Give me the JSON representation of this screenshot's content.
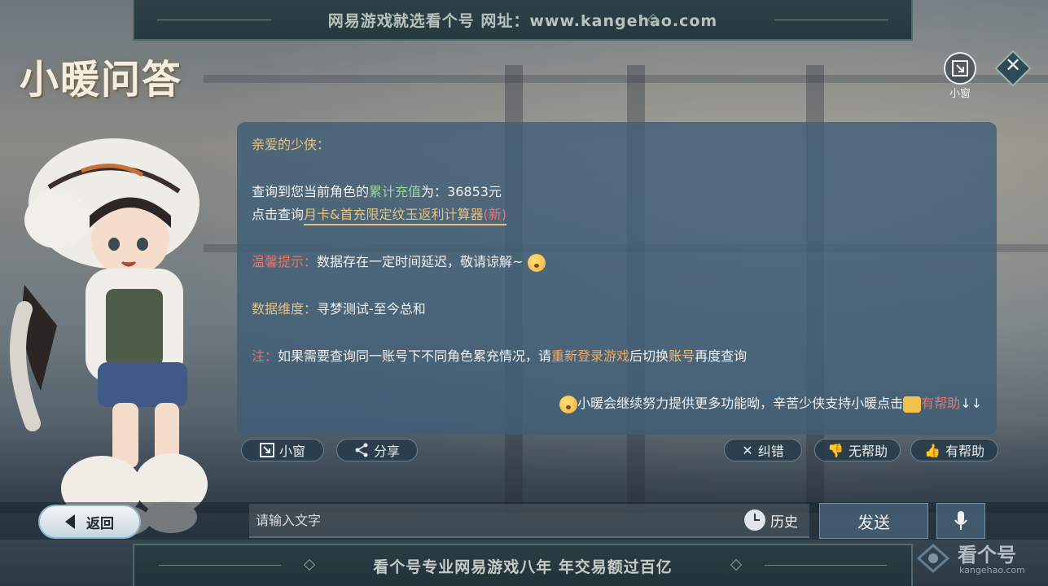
{
  "top_banner": {
    "text": "网易游戏就选看个号  网址：www.kangehao.com"
  },
  "title": "小暖问答",
  "controls": {
    "mini_window_label": "小窗",
    "close_icon": "close-diamond-icon"
  },
  "message": {
    "greeting": "亲爱的少侠：",
    "recharge": {
      "prefix": "查询到您当前角色的",
      "highlight": "累计充值",
      "suffix": "为：36853元"
    },
    "calculator": {
      "prefix": "点击查询",
      "link": "月卡&首充限定纹玉返利计算器",
      "tag": "(新)"
    },
    "tip": {
      "label": "温馨提示：",
      "text": "数据存在一定时间延迟，敬请谅解~"
    },
    "dimension": {
      "label": "数据维度：",
      "text": "寻梦测试-至今总和"
    },
    "note": {
      "label": "注：",
      "part1": "如果需要查询同一账号下不同角色累充情况，请",
      "highlight1": "重新登录游戏",
      "part2": "后切换",
      "highlight2": "账号",
      "part3": "再度查询"
    },
    "footer": {
      "text": "小暖会继续努力提供更多功能呦，辛苦少侠支持小暖点击",
      "helpful": "有帮助",
      "arrows": "↓↓"
    }
  },
  "actions": {
    "mini_window": "小窗",
    "share": "分享",
    "correct": "纠错",
    "not_helpful": "无帮助",
    "helpful": "有帮助"
  },
  "input_bar": {
    "back": "返回",
    "placeholder": "请输入文字",
    "history": "历史",
    "send": "发送"
  },
  "bottom_banner": {
    "text": "看个号专业网易游戏八年  年交易额过百亿"
  },
  "logo": {
    "name": "看个号",
    "url": "kangehao.com"
  }
}
